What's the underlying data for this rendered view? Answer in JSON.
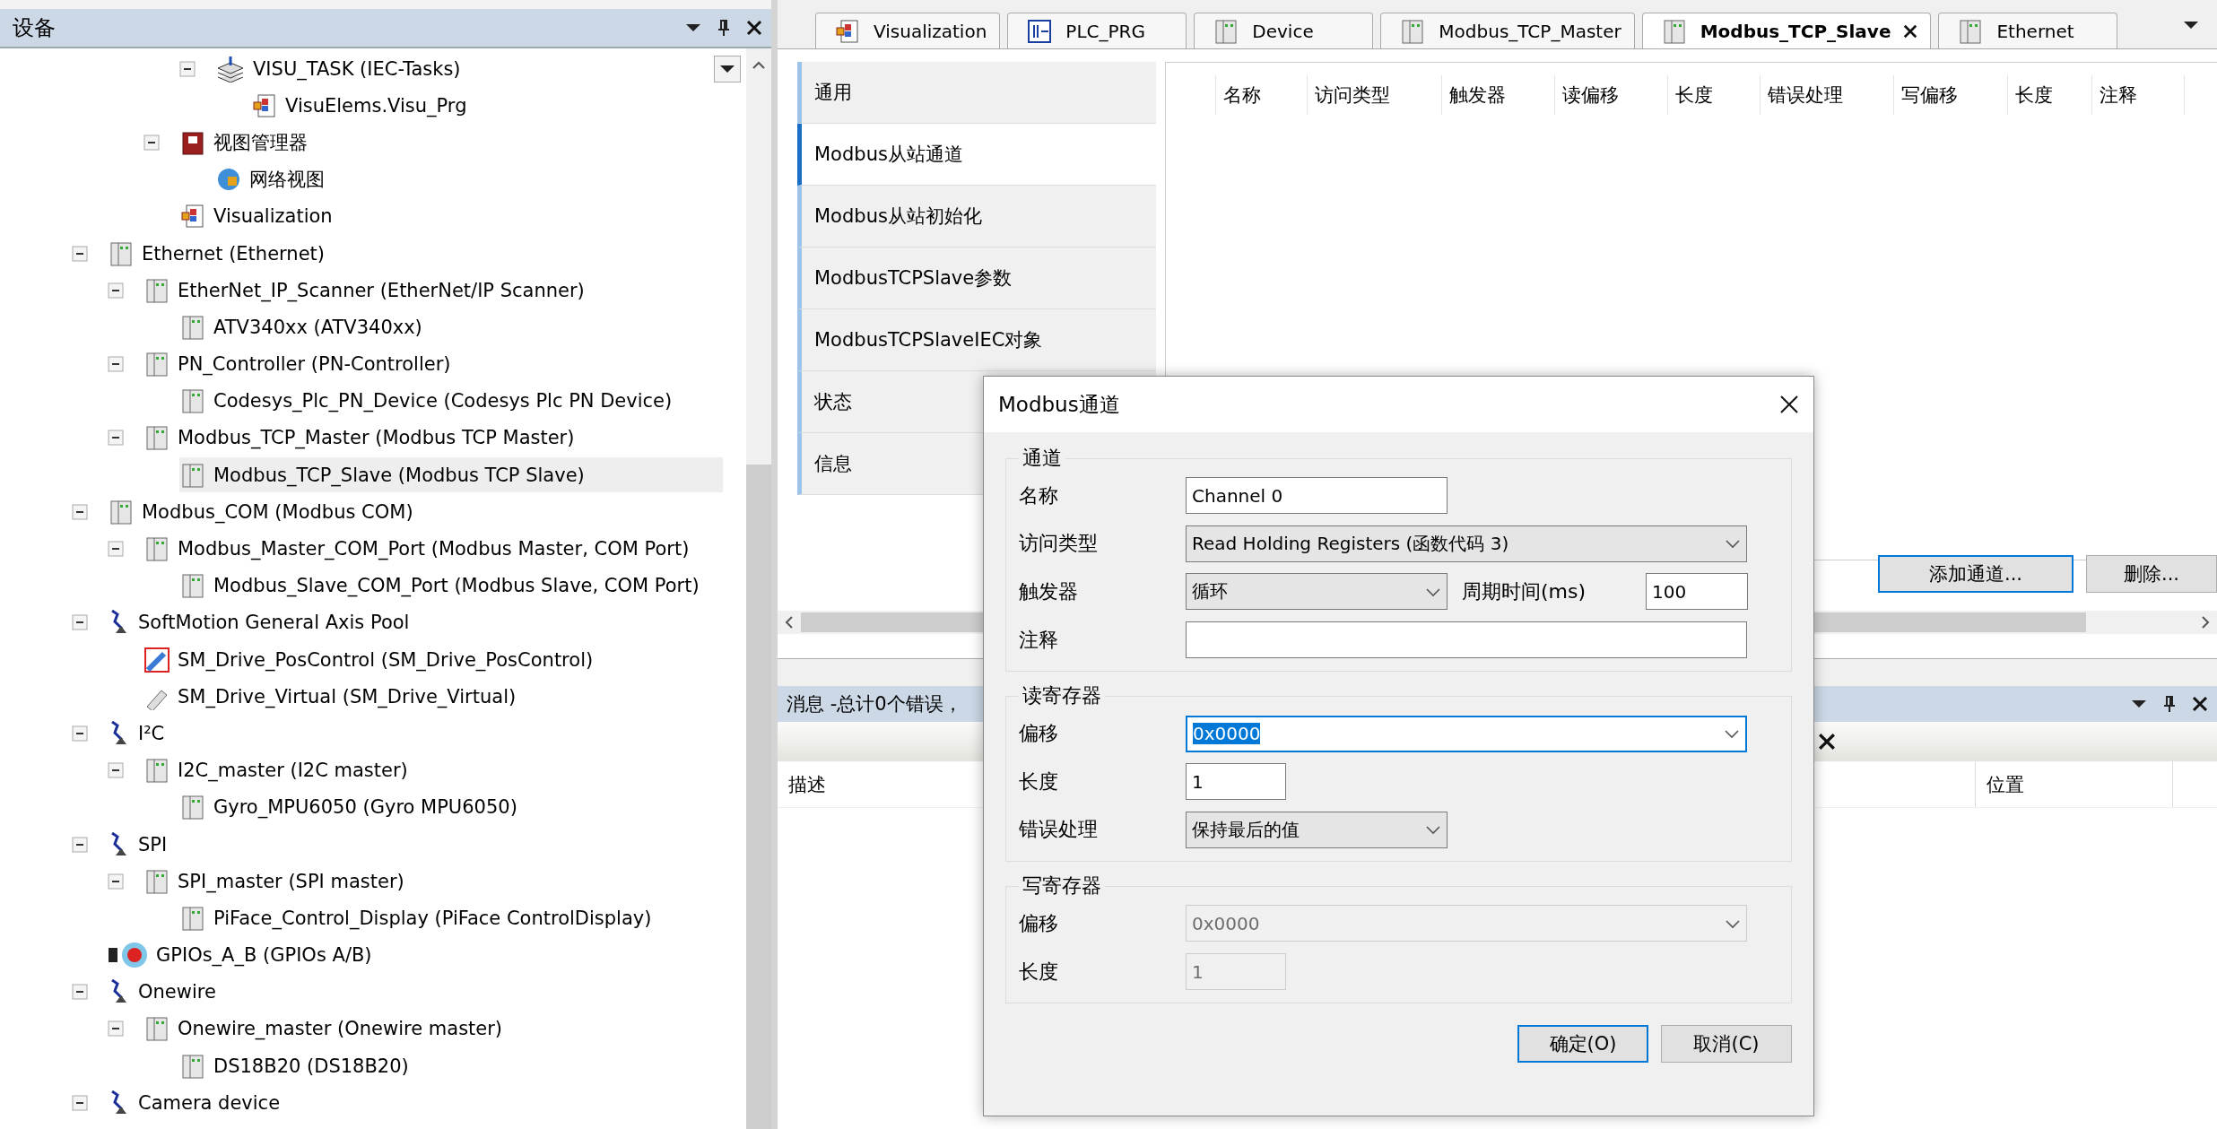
{
  "device_panel": {
    "title": "设备",
    "tree": [
      {
        "children": [
          {
            "children": [
              {
                "children": [
                  {
                    "label": "VISU_TASK (IEC-Tasks)",
                    "kind": "task",
                    "expanded": true,
                    "selected": false,
                    "children": [
                      {
                        "label": "VisuElems.Visu_Prg",
                        "kind": "visu",
                        "selected": false
                      }
                    ]
                  }
                ]
              },
              {
                "label": "视图管理器",
                "kind": "manager",
                "expanded": true,
                "selected": false,
                "children": [
                  {
                    "label": "网络视图",
                    "kind": "network",
                    "selected": false
                  }
                ]
              },
              {
                "label": "Visualization",
                "kind": "visu",
                "selected": false
              }
            ]
          }
        ]
      },
      {
        "label": "Ethernet (Ethernet)",
        "kind": "device",
        "expanded": true,
        "selected": false,
        "children": [
          {
            "label": "EtherNet_IP_Scanner (EtherNet/IP Scanner)",
            "kind": "device",
            "expanded": true,
            "selected": false,
            "children": [
              {
                "label": "ATV340xx (ATV340xx)",
                "kind": "device",
                "selected": false
              }
            ]
          },
          {
            "label": "PN_Controller (PN-Controller)",
            "kind": "device",
            "expanded": true,
            "selected": false,
            "children": [
              {
                "label": "Codesys_Plc_PN_Device (Codesys Plc PN Device)",
                "kind": "device",
                "selected": false
              }
            ]
          },
          {
            "label": "Modbus_TCP_Master (Modbus TCP Master)",
            "kind": "device",
            "expanded": true,
            "selected": false,
            "children": [
              {
                "label": "Modbus_TCP_Slave (Modbus TCP Slave)",
                "kind": "device",
                "selected": true
              }
            ]
          }
        ]
      },
      {
        "label": "Modbus_COM (Modbus COM)",
        "kind": "device",
        "expanded": true,
        "selected": false,
        "children": [
          {
            "label": "Modbus_Master_COM_Port (Modbus Master, COM Port)",
            "kind": "device",
            "expanded": true,
            "selected": false,
            "children": [
              {
                "label": "Modbus_Slave_COM_Port (Modbus Slave, COM Port)",
                "kind": "device",
                "selected": false
              }
            ]
          }
        ]
      },
      {
        "label": "SoftMotion General Axis Pool",
        "kind": "pool",
        "expanded": true,
        "selected": false,
        "children": [
          {
            "label": "SM_Drive_PosControl (SM_Drive_PosControl)",
            "kind": "drive",
            "selected": false
          },
          {
            "label": "SM_Drive_Virtual (SM_Drive_Virtual)",
            "kind": "virtual",
            "selected": false
          }
        ]
      },
      {
        "label": "I²C",
        "kind": "pool",
        "expanded": true,
        "selected": false,
        "children": [
          {
            "label": "I2C_master (I2C master)",
            "kind": "device",
            "expanded": true,
            "selected": false,
            "children": [
              {
                "label": "Gyro_MPU6050 (Gyro MPU6050)",
                "kind": "device",
                "selected": false
              }
            ]
          }
        ]
      },
      {
        "label": "SPI",
        "kind": "pool",
        "expanded": true,
        "selected": false,
        "children": [
          {
            "label": "SPI_master (SPI master)",
            "kind": "device",
            "expanded": true,
            "selected": false,
            "children": [
              {
                "label": "PiFace_Control_Display (PiFace ControlDisplay)",
                "kind": "device",
                "selected": false
              }
            ]
          }
        ]
      },
      {
        "label": "GPIOs_A_B (GPIOs A/B)",
        "kind": "gpio",
        "selected": false
      },
      {
        "label": "Onewire",
        "kind": "pool",
        "expanded": true,
        "selected": false,
        "children": [
          {
            "label": "Onewire_master (Onewire master)",
            "kind": "device",
            "expanded": true,
            "selected": false,
            "children": [
              {
                "label": "DS18B20 (DS18B20)",
                "kind": "device",
                "selected": false
              }
            ]
          }
        ]
      },
      {
        "label": "Camera device",
        "kind": "pool",
        "expanded": true,
        "selected": false
      }
    ]
  },
  "editor_tabs": [
    {
      "label": "Visualization",
      "kind": "visu",
      "selected": false
    },
    {
      "label": "PLC_PRG",
      "kind": "program",
      "selected": false
    },
    {
      "label": "Device",
      "kind": "device",
      "selected": false
    },
    {
      "label": "Modbus_TCP_Master",
      "kind": "device",
      "selected": false
    },
    {
      "label": "Modbus_TCP_Slave",
      "kind": "device",
      "selected": true
    },
    {
      "label": "Ethernet",
      "kind": "device",
      "selected": false
    }
  ],
  "editor": {
    "sections": [
      {
        "label": "通用",
        "selected": false
      },
      {
        "label": "Modbus从站通道",
        "selected": true
      },
      {
        "label": "Modbus从站初始化",
        "selected": false
      },
      {
        "label": "ModbusTCPSlave参数",
        "selected": false
      },
      {
        "label": "ModbusTCPSlaveIEC对象",
        "selected": false
      },
      {
        "label": "状态",
        "selected": false
      },
      {
        "label": "信息",
        "selected": false
      }
    ],
    "columns": [
      "名称",
      "访问类型",
      "触发器",
      "读偏移",
      "长度",
      "错误处理",
      "写偏移",
      "长度",
      "注释"
    ],
    "buttons": [
      {
        "label": "添加通道...",
        "focused": true
      },
      {
        "label": "删除...",
        "focused": false
      }
    ]
  },
  "messages": {
    "title": "消息 -总计0个错误，",
    "columns": [
      "描述",
      "位置"
    ]
  },
  "dialog": {
    "title": "Modbus通道",
    "groups": [
      {
        "title": "通道",
        "rows": [
          {
            "label": "名称",
            "field": {
              "kind": "text",
              "value": "Channel 0",
              "disabled": false,
              "focused": false
            }
          },
          {
            "label": "访问类型",
            "field": {
              "kind": "dropdown",
              "value": "Read Holding Registers (函数代码 3)",
              "disabled": false,
              "focused": false
            }
          },
          {
            "label": "触发器",
            "field": {
              "kind": "dropdown",
              "value": "循环",
              "disabled": false,
              "focused": false
            },
            "extra": {
              "label": "周期时间(ms)",
              "field": {
                "kind": "text",
                "value": "100",
                "disabled": false,
                "focused": false
              }
            }
          },
          {
            "label": "注释",
            "field": {
              "kind": "text",
              "disabled": false,
              "focused": false
            }
          }
        ]
      },
      {
        "title": "读寄存器",
        "rows": [
          {
            "label": "偏移",
            "field": {
              "kind": "combo",
              "value": "0x0000",
              "disabled": false,
              "focused": true
            }
          },
          {
            "label": "长度",
            "field": {
              "kind": "text",
              "value": "1",
              "disabled": false,
              "focused": false
            }
          },
          {
            "label": "错误处理",
            "field": {
              "kind": "dropdown",
              "value": "保持最后的值",
              "disabled": false,
              "focused": false
            }
          }
        ]
      },
      {
        "title": "写寄存器",
        "rows": [
          {
            "label": "偏移",
            "field": {
              "kind": "combo",
              "value": "0x0000",
              "disabled": true,
              "focused": false
            }
          },
          {
            "label": "长度",
            "field": {
              "kind": "text",
              "value": "1",
              "disabled": true,
              "focused": false
            }
          }
        ]
      }
    ],
    "buttons": [
      {
        "label": "确定(O)",
        "focused": true
      },
      {
        "label": "取消(C)",
        "focused": false
      }
    ]
  }
}
